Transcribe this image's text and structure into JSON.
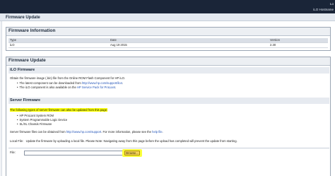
{
  "topbar": {
    "user": "Lo",
    "hostname": "iLO Hostname"
  },
  "page_title": "Firmware Update",
  "firmware_info": {
    "title": "Firmware Information",
    "columns": [
      "Type",
      "Date",
      "Version"
    ],
    "rows": [
      {
        "type": "iLO",
        "date": "Aug 19 2015",
        "version": "2.30"
      }
    ]
  },
  "firmware_update": {
    "title": "Firmware Update",
    "ilo_heading": "iLO Firmware",
    "ilo_obtain": "Obtain the firmware image (.bin) file from the Online ROM Flash Component for HP iLO.",
    "ilo_bullets": [
      {
        "prefix": "The latest component can be downloaded from ",
        "link": "http://www.hp.com/support/ilo4",
        "suffix": "."
      },
      {
        "prefix": "The iLO component is also available on the ",
        "link": "HP Service Pack for ProLiant",
        "suffix": "."
      }
    ],
    "server_heading": "Server Firmware",
    "server_intro": "The following types of server firmware can also be updated from this page:",
    "server_items": [
      "HP ProLiant System ROM",
      "System Programmable Logic Device",
      "SL/XL Chassis Firmware"
    ],
    "obtain_prefix": "Server firmware files can be obtained from ",
    "obtain_link": "http://www.hp.com/support",
    "obtain_middle": ". For more information, please see the ",
    "help_link": "help file",
    "obtain_suffix": ".",
    "local_file_label": "Local File:",
    "local_file_note": "Update the firmware by uploading a local file.  Please Note:  Navigating away from this page before the upload has completed will prevent the update from starting.",
    "file_label": "File:",
    "browse_label": "Browse..."
  }
}
